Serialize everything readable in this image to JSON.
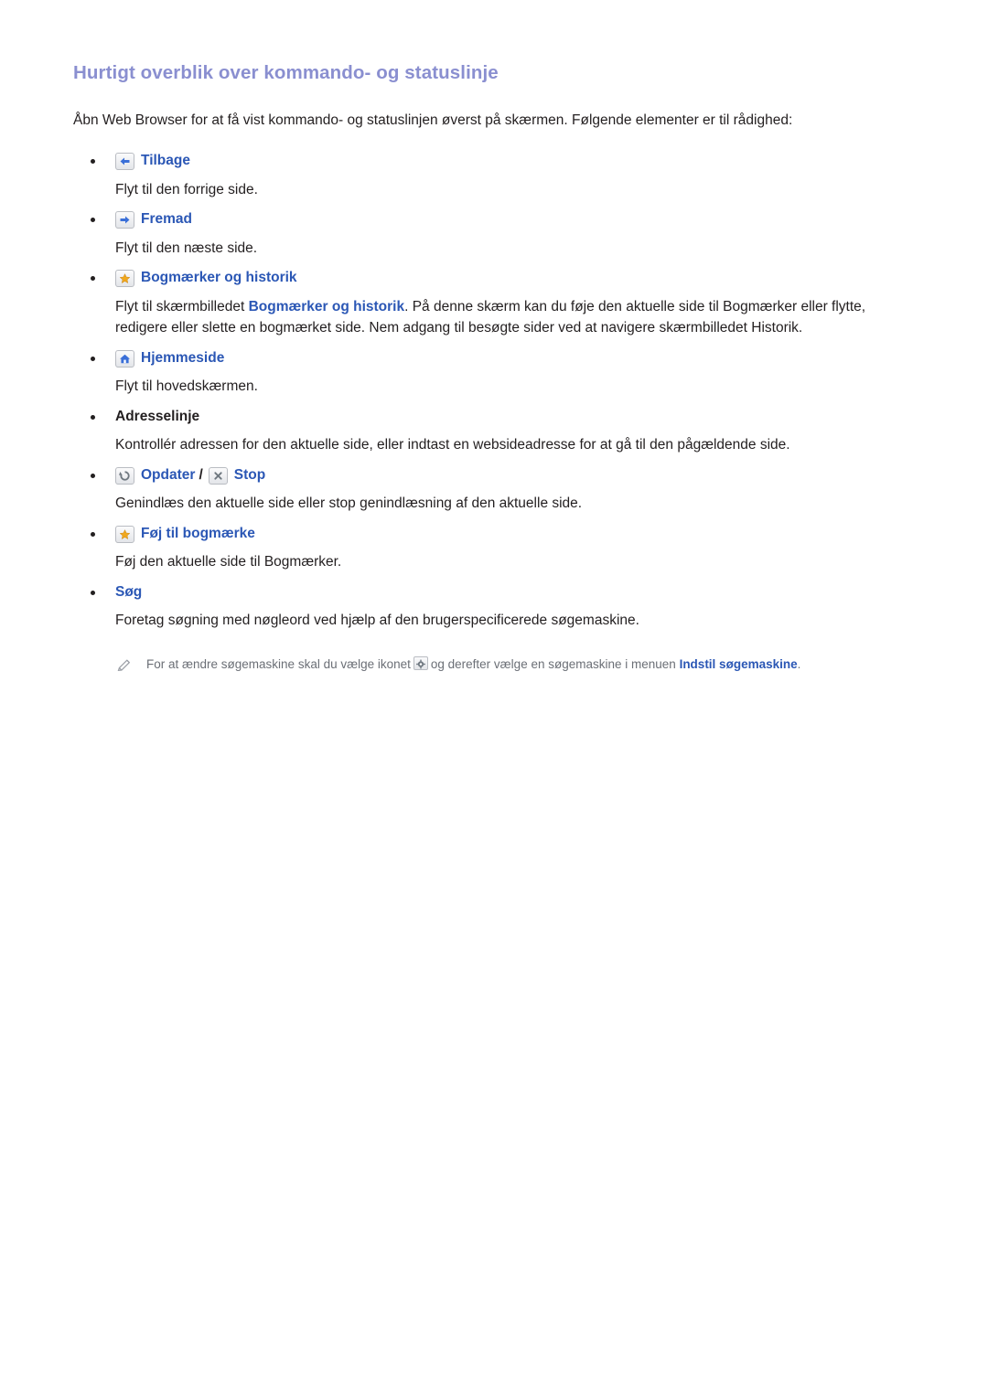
{
  "page": {
    "title": "Hurtigt overblik over kommando- og statuslinje",
    "intro": "Åbn Web Browser for at få vist kommando- og statuslinjen øverst på skærmen. Følgende elementer er til rådighed:"
  },
  "items": [
    {
      "icon": "back-arrow-icon",
      "label": "Tilbage",
      "desc": "Flyt til den forrige side."
    },
    {
      "icon": "forward-arrow-icon",
      "label": "Fremad",
      "desc": "Flyt til den næste side."
    },
    {
      "icon": "star-icon",
      "label": "Bogmærker og historik",
      "desc_pre": "Flyt til skærmbilledet ",
      "desc_bold": "Bogmærker og historik",
      "desc_post": ". På denne skærm kan du føje den aktuelle side til Bogmærker eller flytte, redigere eller slette en bogmærket side. Nem adgang til besøgte sider ved at navigere skærmbilledet Historik."
    },
    {
      "icon": "home-icon",
      "label": "Hjemmeside",
      "desc": "Flyt til hovedskærmen."
    },
    {
      "icon": "none",
      "label": "Adresselinje",
      "desc": "Kontrollér adressen for den aktuelle side, eller indtast en websideadresse for at gå til den pågældende side."
    },
    {
      "icon": "refresh-icon",
      "label": "Opdater",
      "separator": "/",
      "icon2": "stop-icon",
      "label2": "Stop",
      "desc": "Genindlæs den aktuelle side eller stop genindlæsning af den aktuelle side."
    },
    {
      "icon": "star-icon",
      "label": "Føj til bogmærke",
      "desc": "Føj den aktuelle side til Bogmærker."
    },
    {
      "icon": "none",
      "label": "Søg",
      "desc": "Foretag søgning med nøgleord ved hjælp af den brugerspecificerede søgemaskine."
    }
  ],
  "note": {
    "icon": "pencil-icon",
    "text_pre": "For at ændre søgemaskine skal du vælge ikonet",
    "inline_icon": "gear-icon",
    "text_mid": "og derefter vælge en søgemaskine i menuen",
    "highlight": "Indstil søgemaskine",
    "text_post": "."
  },
  "colors": {
    "title": "#8a8fd0",
    "link": "#2b57b5",
    "body": "#231f20",
    "note": "#6b6f76"
  }
}
